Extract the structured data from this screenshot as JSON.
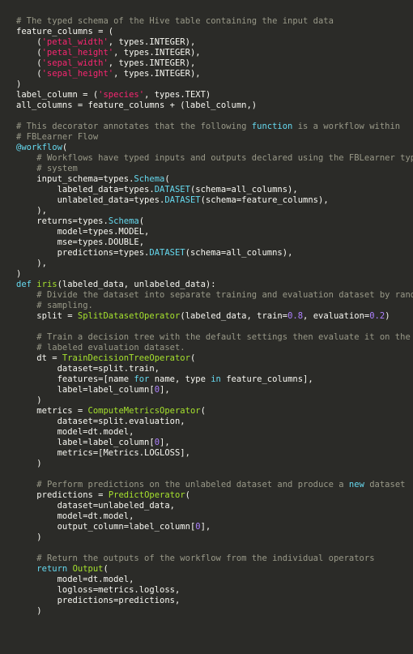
{
  "code": {
    "c01": "# The typed schema of the Hive table containing the input data",
    "l02a": "feature_columns = (",
    "s03": "'petal_width'",
    "l03b": ", types.INTEGER),",
    "s04": "'petal_height'",
    "l04b": ", types.INTEGER),",
    "s05": "'sepal_width'",
    "l05b": ", types.INTEGER),",
    "s06": "'sepal_height'",
    "l06b": ", types.INTEGER),",
    "l07": ")",
    "l08a": "label_column = (",
    "s08": "'species'",
    "l08b": ", types.TEXT)",
    "l09": "all_columns = feature_columns + (label_column,)",
    "c11a": "# This decorator annotates that the following ",
    "k11": "function",
    "c11b": " is a workflow within",
    "c12": "# FBLearner Flow",
    "k13": "@workflow",
    "l13b": "(",
    "c14": "# Workflows have typed inputs and outputs declared using the FBLearner type",
    "c15": "# system",
    "l16a": "input_schema=types.",
    "t16": "Schema",
    "l16b": "(",
    "l17a": "labeled_data=types.",
    "t17": "DATASET",
    "l17b": "(schema=all_columns),",
    "l18a": "unlabeled_data=types.",
    "t18": "DATASET",
    "l18b": "(schema=feature_columns),",
    "l19": "),",
    "l20a": "returns=types.",
    "t20": "Schema",
    "l20b": "(",
    "l21": "model=types.MODEL,",
    "l22": "mse=types.DOUBLE,",
    "l23a": "predictions=types.",
    "t23": "DATASET",
    "l23b": "(schema=all_columns),",
    "l24": "),",
    "l25": ")",
    "k26a": "def ",
    "f26": "iris",
    "l26b": "(labeled_data, unlabeled_data):",
    "c27": "# Divide the dataset into separate training and evaluation dataset by random",
    "c28": "# sampling.",
    "l29a": "split = ",
    "f29": "SplitDatasetOperator",
    "l29b": "(labeled_data, train=",
    "n29a": "0.8",
    "l29c": ", evaluation=",
    "n29b": "0.2",
    "l29d": ")",
    "c31": "# Train a decision tree with the default settings then evaluate it on the",
    "c32": "# labeled evaluation dataset.",
    "l33a": "dt = ",
    "f33": "TrainDecisionTreeOperator",
    "l33b": "(",
    "l34": "dataset=split.train,",
    "l35a": "features=[name ",
    "k35a": "for",
    "l35b": " name, type ",
    "k35b": "in",
    "l35c": " feature_columns],",
    "l36a": "label=label_column[",
    "n36": "0",
    "l36b": "],",
    "l37": ")",
    "l38a": "metrics = ",
    "f38": "ComputeMetricsOperator",
    "l38b": "(",
    "l39": "dataset=split.evaluation,",
    "l40": "model=dt.model,",
    "l41a": "label=label_column[",
    "n41": "0",
    "l41b": "],",
    "l42": "metrics=[Metrics.LOGLOSS],",
    "l43": ")",
    "c45a": "# Perform predictions on the unlabeled dataset and produce a ",
    "k45": "new",
    "c45b": " dataset",
    "l46a": "predictions = ",
    "f46": "PredictOperator",
    "l46b": "(",
    "l47": "dataset=unlabeled_data,",
    "l48": "model=dt.model,",
    "l49a": "output_column=label_column[",
    "n49": "0",
    "l49b": "],",
    "l50": ")",
    "c52": "# Return the outputs of the workflow from the individual operators",
    "k53a": "return",
    "l53b": " ",
    "f53": "Output",
    "l53c": "(",
    "l54": "model=dt.model,",
    "l55": "logloss=metrics.logloss,",
    "l56": "predictions=predictions,",
    "l57": ")"
  }
}
